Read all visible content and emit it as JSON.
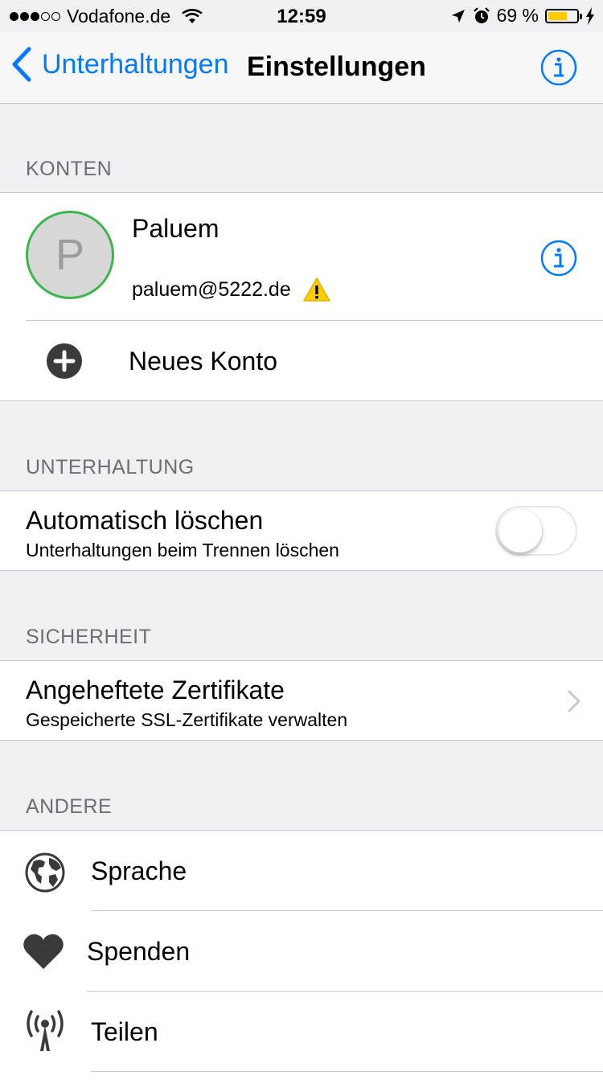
{
  "status_bar": {
    "carrier": "Vodafone.de",
    "time": "12:59",
    "battery_text": "69 %",
    "battery_level": 0.69,
    "signal_bars_filled": 3,
    "signal_bars_total": 5
  },
  "nav": {
    "back_label": "Unterhaltungen",
    "title": "Einstellungen",
    "accent": "#007aff"
  },
  "accounts": {
    "header": "KONTEN",
    "account": {
      "avatar_letter": "P",
      "name": "Paluem",
      "email": "paluem@5222.de",
      "status_color": "#3cb54a"
    },
    "new_account_label": "Neues Konto"
  },
  "conversation": {
    "header": "UNTERHALTUNG",
    "auto_delete_title": "Automatisch löschen",
    "auto_delete_subtitle": "Unterhaltungen beim Trennen löschen",
    "auto_delete_on": false
  },
  "security": {
    "header": "SICHERHEIT",
    "pinned_title": "Angeheftete Zertifikate",
    "pinned_subtitle": "Gespeicherte SSL-Zertifikate verwalten"
  },
  "other": {
    "header": "ANDERE",
    "items": [
      {
        "label": "Sprache",
        "icon": "globe-icon"
      },
      {
        "label": "Spenden",
        "icon": "heart-icon"
      },
      {
        "label": "Teilen",
        "icon": "broadcast-icon"
      }
    ]
  }
}
